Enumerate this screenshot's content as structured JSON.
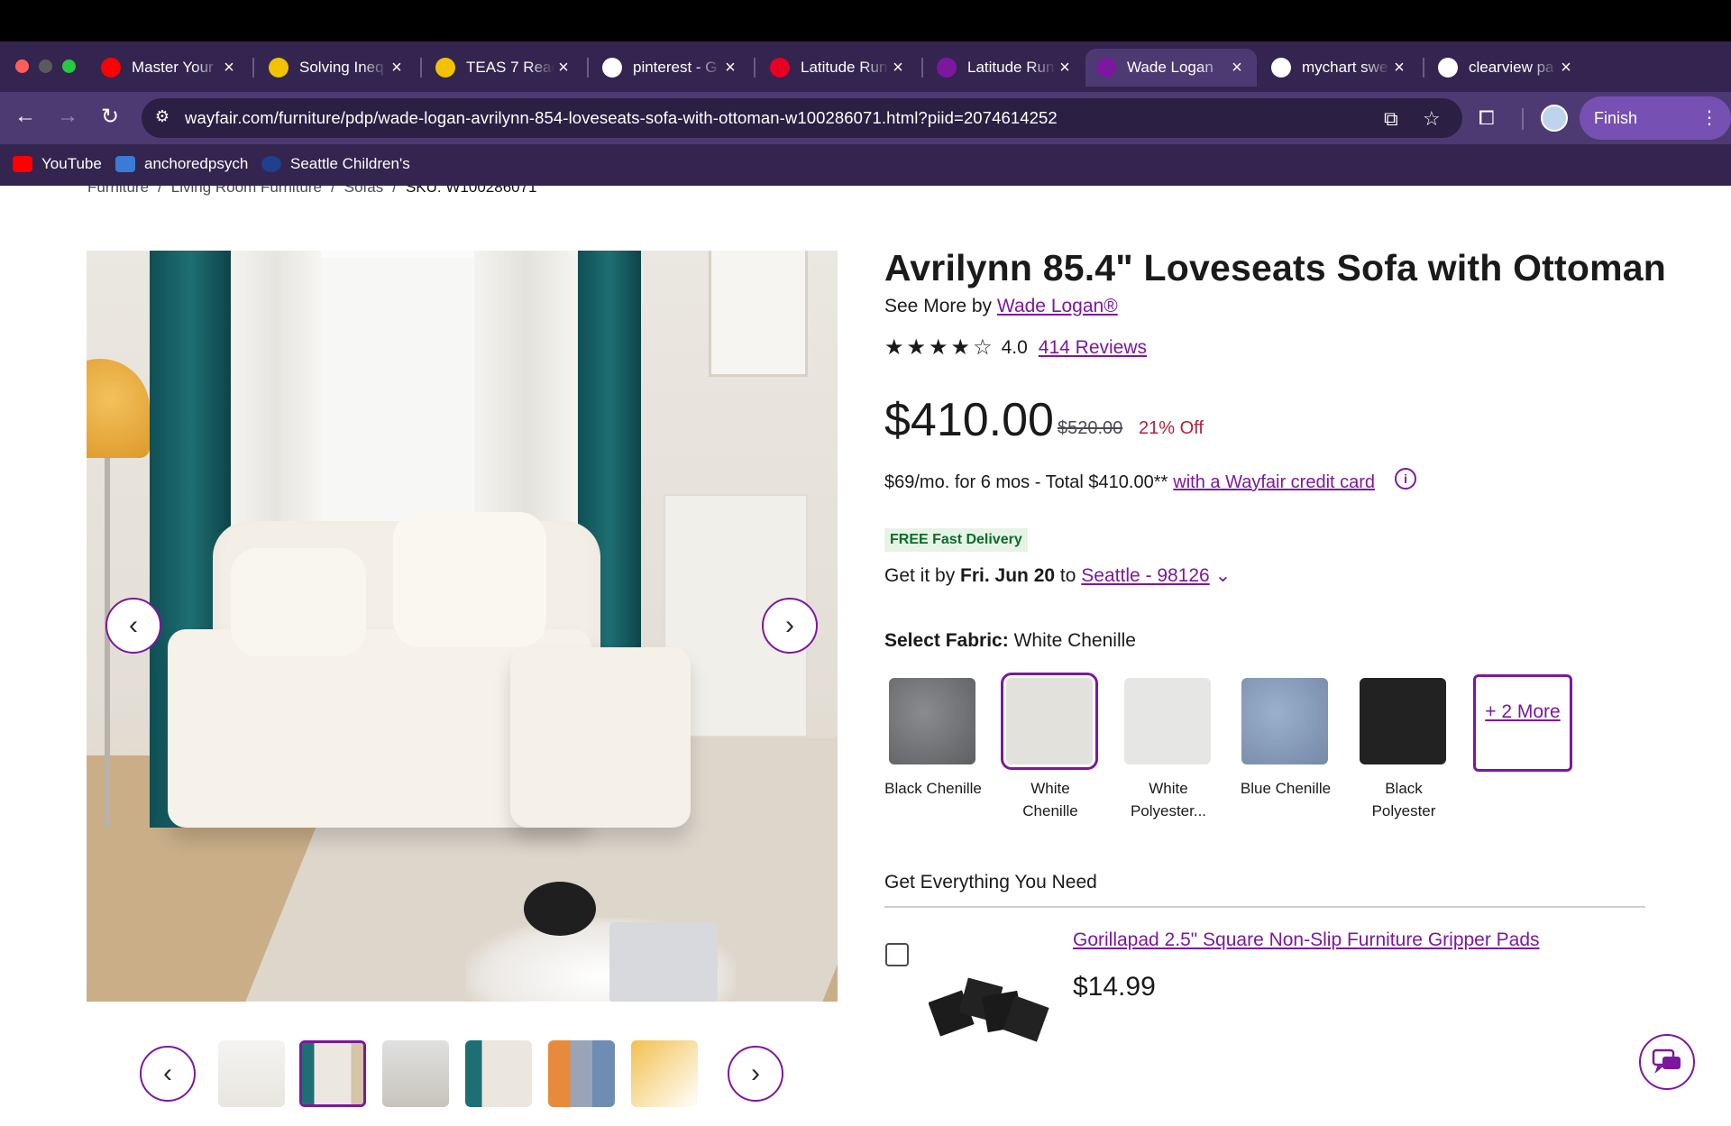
{
  "browser": {
    "tabs": [
      {
        "title": "Master Your",
        "favicon": "youtube-icon",
        "color": "#ff0000"
      },
      {
        "title": "Solving Ineq",
        "favicon": "checkmark-icon",
        "color": "#f2c200"
      },
      {
        "title": "TEAS 7 Reac",
        "favicon": "checkmark-icon",
        "color": "#f2c200"
      },
      {
        "title": "pinterest - G",
        "favicon": "google-icon",
        "color": "#ffffff"
      },
      {
        "title": "Latitude Run",
        "favicon": "pinterest-icon",
        "color": "#e60023"
      },
      {
        "title": "Latitude Run",
        "favicon": "wayfair-icon",
        "color": "#7b189f"
      },
      {
        "title": "Wade Logan",
        "favicon": "wayfair-icon",
        "color": "#7b189f",
        "active": true
      },
      {
        "title": "mychart swe",
        "favicon": "google-icon",
        "color": "#ffffff"
      },
      {
        "title": "clearview pa",
        "favicon": "google-icon",
        "color": "#ffffff"
      }
    ],
    "new_tab": "+",
    "url": "wayfair.com/furniture/pdp/wade-logan-avrilynn-854-loveseats-sofa-with-ottoman-w100286071.html?piid=2074614252",
    "finish_update": "Finish update",
    "bookmarks": [
      {
        "label": "YouTube",
        "icon": "youtube-icon",
        "color": "#ff0000"
      },
      {
        "label": "anchoredpsych",
        "icon": "anchoredpsych-icon",
        "color": "#3a7bd5"
      },
      {
        "label": "Seattle Children's",
        "icon": "seattle-childrens-icon",
        "color": "#1f3f8f"
      }
    ]
  },
  "breadcrumb": [
    "Furniture",
    "/",
    "Living Room Furniture",
    "/",
    "Sofas",
    "/",
    "SKU: W100286071"
  ],
  "product": {
    "title": "Avrilynn 85.4\" Loveseats Sofa with Ottoman",
    "see_more_prefix": "See More by",
    "brand": "Wade Logan®",
    "rating": "4.0",
    "rating_stars": 4,
    "reviews": "414 Reviews",
    "price": "$410.00",
    "old_price": "$520.00",
    "discount": "21% Off",
    "financing_text": "$69/mo. for 6 mos - Total $410.00**",
    "financing_link": "with a Wayfair credit card",
    "delivery_badge_strong": "FREE Fast Delivery",
    "get_it_prefix": "Get it by",
    "get_it_date": "Fri. Jun 20",
    "get_it_to": "to",
    "location": "Seattle - 98126",
    "fabric_label": "Select Fabric:",
    "fabric_selected": "White Chenille",
    "swatches": [
      {
        "label": "Black Chenille",
        "color": "#6f7073"
      },
      {
        "label": "White Chenille",
        "color": "#e3e1dc"
      },
      {
        "label": "White Polyester...",
        "color": "#e6e6e4"
      },
      {
        "label": "Blue Chenille",
        "color": "#8498b6"
      },
      {
        "label": "Black Polyester",
        "color": "#222222"
      }
    ],
    "more_swatches": "+ 2 More"
  },
  "addons": {
    "title": "Get Everything You Need",
    "item_name": "Gorillapad 2.5\" Square Non-Slip Furniture Gripper Pads",
    "item_price": "$14.99"
  }
}
